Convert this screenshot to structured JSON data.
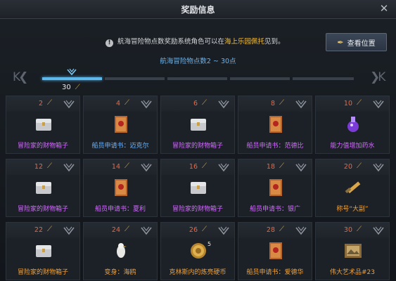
{
  "window": {
    "title": "奖励信息",
    "close_label": "✕"
  },
  "notice": {
    "prefix": "航海冒险物点数奖励系统角色可以在",
    "highlight": "海上乐园佩托",
    "suffix": "见到。"
  },
  "location_button": {
    "label": "查看位置"
  },
  "range_label": "航海冒险物点数2 ~ 30点",
  "progress": {
    "points": "30",
    "arrow_left": "K❮",
    "arrow_right": "❯K"
  },
  "colors": {
    "accent": "#5fb8ea",
    "number": "#e06a4a",
    "purple": "#d26cff",
    "blue": "#6cb5ff",
    "orange": "#f2a23a"
  },
  "rewards": [
    {
      "points": "2",
      "name": "冒险家的财物箱子",
      "quality": "purple",
      "icon": "chest-icon"
    },
    {
      "points": "4",
      "name": "船员申请书：迈克尔",
      "quality": "blue",
      "icon": "crew-letter-icon"
    },
    {
      "points": "6",
      "name": "冒险家的财物箱子",
      "quality": "purple",
      "icon": "chest-icon"
    },
    {
      "points": "8",
      "name": "船员申请书：范德比",
      "quality": "purple",
      "icon": "crew-letter-icon"
    },
    {
      "points": "10",
      "name": "能力值增加药水",
      "quality": "purple",
      "icon": "potion-icon"
    },
    {
      "points": "12",
      "name": "冒险家的财物箱子",
      "quality": "purple",
      "icon": "chest-icon"
    },
    {
      "points": "14",
      "name": "船员申请书：夏利",
      "quality": "purple",
      "icon": "crew-letter-icon"
    },
    {
      "points": "16",
      "name": "冒险家的财物箱子",
      "quality": "purple",
      "icon": "chest-icon"
    },
    {
      "points": "18",
      "name": "船员申请书：银广",
      "quality": "purple",
      "icon": "crew-letter-icon"
    },
    {
      "points": "20",
      "name": "称号“大副”",
      "quality": "orange",
      "icon": "telescope-icon"
    },
    {
      "points": "22",
      "name": "冒险家的财物箱子",
      "quality": "orange",
      "icon": "chest-icon"
    },
    {
      "points": "24",
      "name": "变身：海鸥",
      "quality": "orange",
      "icon": "seagull-icon"
    },
    {
      "points": "26",
      "name": "克林斯内的炼亮硬币",
      "quality": "orange",
      "icon": "coin-icon",
      "badge_count": "5"
    },
    {
      "points": "28",
      "name": "船员申请书：爱德华",
      "quality": "orange",
      "icon": "crew-letter-icon"
    },
    {
      "points": "30",
      "name": "伟大艺术品#23",
      "quality": "orange",
      "icon": "painting-icon"
    }
  ]
}
